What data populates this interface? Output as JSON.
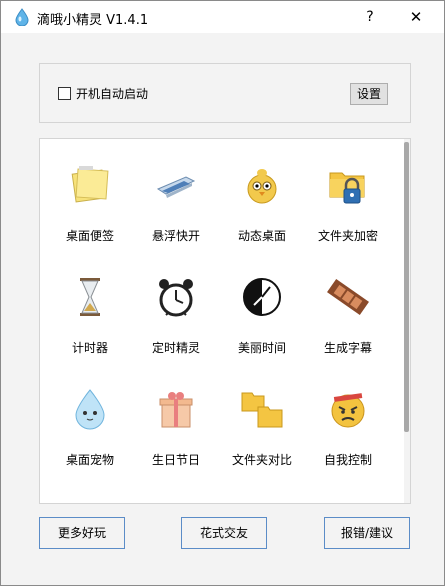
{
  "window": {
    "title": "滴哦小精灵 V1.4.1",
    "help_label": "?",
    "close_label": "✕"
  },
  "top_panel": {
    "autostart_label": "开机自动启动",
    "autostart_checked": false,
    "settings_label": "设置"
  },
  "tools": [
    {
      "label": "桌面便签",
      "icon": "sticky-note-icon"
    },
    {
      "label": "悬浮快开",
      "icon": "floating-launcher-icon"
    },
    {
      "label": "动态桌面",
      "icon": "chick-icon"
    },
    {
      "label": "文件夹加密",
      "icon": "folder-lock-icon"
    },
    {
      "label": "计时器",
      "icon": "hourglass-icon"
    },
    {
      "label": "定时精灵",
      "icon": "alarm-clock-icon"
    },
    {
      "label": "美丽时间",
      "icon": "clock-face-icon"
    },
    {
      "label": "生成字幕",
      "icon": "film-strip-icon"
    },
    {
      "label": "桌面宠物",
      "icon": "water-drop-pet-icon"
    },
    {
      "label": "生日节日",
      "icon": "gift-box-icon"
    },
    {
      "label": "文件夹对比",
      "icon": "folders-compare-icon"
    },
    {
      "label": "自我控制",
      "icon": "angry-face-icon"
    }
  ],
  "bottom_buttons": {
    "more_fun": "更多好玩",
    "fancy_friends": "花式交友",
    "feedback": "报错/建议"
  },
  "colors": {
    "accent_border": "#5b8cc7",
    "titlebar": "#ffffff",
    "panel": "#f3f3f3"
  }
}
